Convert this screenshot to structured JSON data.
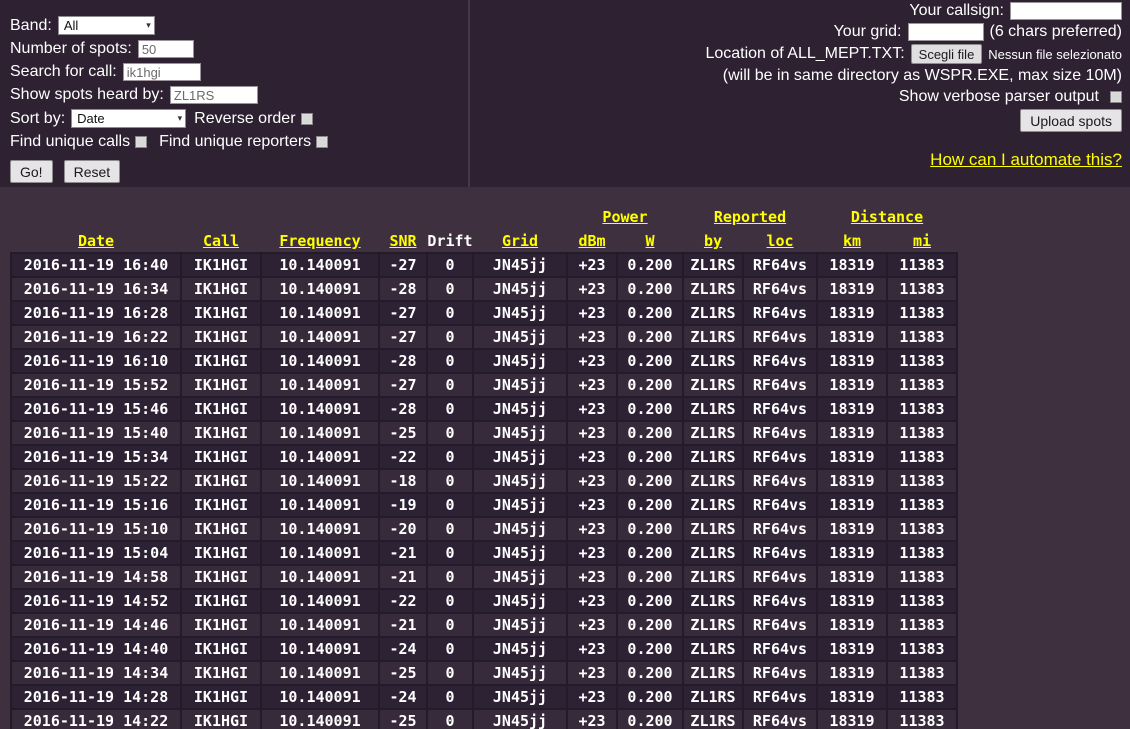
{
  "colors": {
    "page_bg": "#3f3040",
    "panel_bg": "#2d2132",
    "divider": "#463648",
    "cell_bg_odd": "#2d2134",
    "cell_bg_even": "#372a3b",
    "cell_border": "#241b2a",
    "link_yellow": "#ffff00",
    "text_white": "#ffffff"
  },
  "form_left": {
    "band_label": "Band:",
    "band_value": "All",
    "spots_label": "Number of spots:",
    "spots_value": "50",
    "search_label": "Search for call:",
    "search_value": "ik1hgi",
    "heard_label": "Show spots heard by:",
    "heard_value": "ZL1RS",
    "sort_label": "Sort by:",
    "sort_value": "Date",
    "reverse_label": "Reverse order",
    "unique_calls_label": "Find unique calls",
    "unique_reporters_label": "Find unique reporters",
    "go_button": "Go!",
    "reset_button": "Reset"
  },
  "form_right": {
    "callsign_label": "Your callsign:",
    "grid_label": "Your grid:",
    "grid_hint": "(6 chars preferred)",
    "file_label": "Location of ALL_MEPT.TXT:",
    "file_button": "Scegli file",
    "file_status": "Nessun file selezionato",
    "file_hint": "(will be in same directory as WSPR.EXE, max size 10M)",
    "verbose_label": "Show verbose parser output",
    "upload_button": "Upload spots",
    "automate_link": "How can I automate this?"
  },
  "table": {
    "group_headers": [
      {
        "label": "Power",
        "span": 2
      },
      {
        "label": "Reported",
        "span": 2
      },
      {
        "label": "Distance",
        "span": 2
      }
    ],
    "columns": [
      "Date",
      "Call",
      "Frequency",
      "SNR",
      "Drift",
      "Grid",
      "dBm",
      "W",
      "by",
      "loc",
      "km",
      "mi"
    ],
    "rows": [
      [
        "2016-11-19 16:40",
        "IK1HGI",
        "10.140091",
        "-27",
        "0",
        "JN45jj",
        "+23",
        "0.200",
        "ZL1RS",
        "RF64vs",
        "18319",
        "11383"
      ],
      [
        "2016-11-19 16:34",
        "IK1HGI",
        "10.140091",
        "-28",
        "0",
        "JN45jj",
        "+23",
        "0.200",
        "ZL1RS",
        "RF64vs",
        "18319",
        "11383"
      ],
      [
        "2016-11-19 16:28",
        "IK1HGI",
        "10.140091",
        "-27",
        "0",
        "JN45jj",
        "+23",
        "0.200",
        "ZL1RS",
        "RF64vs",
        "18319",
        "11383"
      ],
      [
        "2016-11-19 16:22",
        "IK1HGI",
        "10.140091",
        "-27",
        "0",
        "JN45jj",
        "+23",
        "0.200",
        "ZL1RS",
        "RF64vs",
        "18319",
        "11383"
      ],
      [
        "2016-11-19 16:10",
        "IK1HGI",
        "10.140091",
        "-28",
        "0",
        "JN45jj",
        "+23",
        "0.200",
        "ZL1RS",
        "RF64vs",
        "18319",
        "11383"
      ],
      [
        "2016-11-19 15:52",
        "IK1HGI",
        "10.140091",
        "-27",
        "0",
        "JN45jj",
        "+23",
        "0.200",
        "ZL1RS",
        "RF64vs",
        "18319",
        "11383"
      ],
      [
        "2016-11-19 15:46",
        "IK1HGI",
        "10.140091",
        "-28",
        "0",
        "JN45jj",
        "+23",
        "0.200",
        "ZL1RS",
        "RF64vs",
        "18319",
        "11383"
      ],
      [
        "2016-11-19 15:40",
        "IK1HGI",
        "10.140091",
        "-25",
        "0",
        "JN45jj",
        "+23",
        "0.200",
        "ZL1RS",
        "RF64vs",
        "18319",
        "11383"
      ],
      [
        "2016-11-19 15:34",
        "IK1HGI",
        "10.140091",
        "-22",
        "0",
        "JN45jj",
        "+23",
        "0.200",
        "ZL1RS",
        "RF64vs",
        "18319",
        "11383"
      ],
      [
        "2016-11-19 15:22",
        "IK1HGI",
        "10.140091",
        "-18",
        "0",
        "JN45jj",
        "+23",
        "0.200",
        "ZL1RS",
        "RF64vs",
        "18319",
        "11383"
      ],
      [
        "2016-11-19 15:16",
        "IK1HGI",
        "10.140091",
        "-19",
        "0",
        "JN45jj",
        "+23",
        "0.200",
        "ZL1RS",
        "RF64vs",
        "18319",
        "11383"
      ],
      [
        "2016-11-19 15:10",
        "IK1HGI",
        "10.140091",
        "-20",
        "0",
        "JN45jj",
        "+23",
        "0.200",
        "ZL1RS",
        "RF64vs",
        "18319",
        "11383"
      ],
      [
        "2016-11-19 15:04",
        "IK1HGI",
        "10.140091",
        "-21",
        "0",
        "JN45jj",
        "+23",
        "0.200",
        "ZL1RS",
        "RF64vs",
        "18319",
        "11383"
      ],
      [
        "2016-11-19 14:58",
        "IK1HGI",
        "10.140091",
        "-21",
        "0",
        "JN45jj",
        "+23",
        "0.200",
        "ZL1RS",
        "RF64vs",
        "18319",
        "11383"
      ],
      [
        "2016-11-19 14:52",
        "IK1HGI",
        "10.140091",
        "-22",
        "0",
        "JN45jj",
        "+23",
        "0.200",
        "ZL1RS",
        "RF64vs",
        "18319",
        "11383"
      ],
      [
        "2016-11-19 14:46",
        "IK1HGI",
        "10.140091",
        "-21",
        "0",
        "JN45jj",
        "+23",
        "0.200",
        "ZL1RS",
        "RF64vs",
        "18319",
        "11383"
      ],
      [
        "2016-11-19 14:40",
        "IK1HGI",
        "10.140091",
        "-24",
        "0",
        "JN45jj",
        "+23",
        "0.200",
        "ZL1RS",
        "RF64vs",
        "18319",
        "11383"
      ],
      [
        "2016-11-19 14:34",
        "IK1HGI",
        "10.140091",
        "-25",
        "0",
        "JN45jj",
        "+23",
        "0.200",
        "ZL1RS",
        "RF64vs",
        "18319",
        "11383"
      ],
      [
        "2016-11-19 14:28",
        "IK1HGI",
        "10.140091",
        "-24",
        "0",
        "JN45jj",
        "+23",
        "0.200",
        "ZL1RS",
        "RF64vs",
        "18319",
        "11383"
      ],
      [
        "2016-11-19 14:22",
        "IK1HGI",
        "10.140091",
        "-25",
        "0",
        "JN45jj",
        "+23",
        "0.200",
        "ZL1RS",
        "RF64vs",
        "18319",
        "11383"
      ]
    ]
  }
}
